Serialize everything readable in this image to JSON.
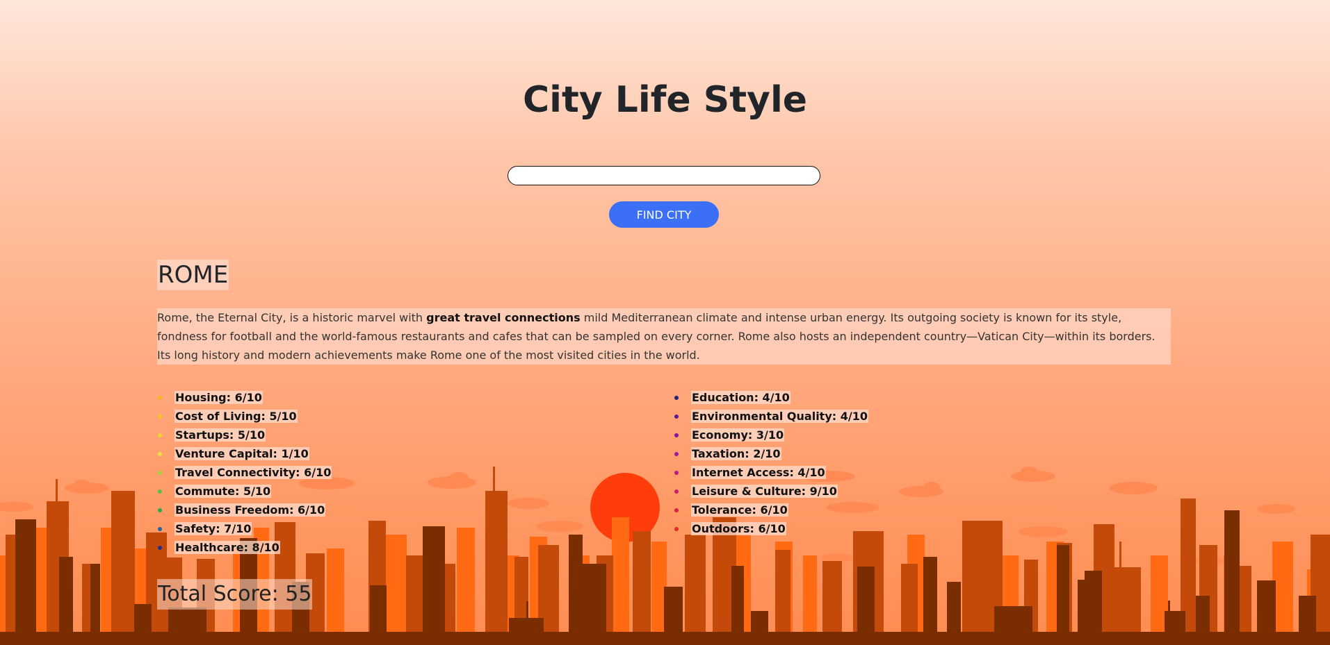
{
  "header": {
    "title": "City Life Style"
  },
  "search": {
    "value": "",
    "placeholder": "",
    "button_label": "FIND CITY"
  },
  "city": {
    "name": "ROME",
    "description_before": "Rome, the Eternal City, is a historic marvel with ",
    "description_bold": "great travel connections",
    "description_after": " mild Mediterranean climate and intense urban energy. Its outgoing society is known for its style, fondness for football and the world-famous restaurants and cafes that can be sampled on every corner. Rome also hosts an independent country—Vatican City—within its borders. Its long history and modern achievements make Rome one of the most visited cities in the world."
  },
  "scores": {
    "left": [
      {
        "label": "Housing: 6/10",
        "color": "#f5b324"
      },
      {
        "label": "Cost of Living: 5/10",
        "color": "#f3c42b"
      },
      {
        "label": "Startups: 5/10",
        "color": "#f1d631"
      },
      {
        "label": "Venture Capital: 1/10",
        "color": "#e8e23a"
      },
      {
        "label": "Travel Connectivity: 6/10",
        "color": "#a6d63b"
      },
      {
        "label": "Commute: 5/10",
        "color": "#50c43b"
      },
      {
        "label": "Business Freedom: 6/10",
        "color": "#2aa84f"
      },
      {
        "label": "Safety: 7/10",
        "color": "#24629d"
      },
      {
        "label": "Healthcare: 8/10",
        "color": "#1b2f8f"
      }
    ],
    "right": [
      {
        "label": "Education: 4/10",
        "color": "#25207a"
      },
      {
        "label": "Environmental Quality: 4/10",
        "color": "#5a1d93"
      },
      {
        "label": "Economy: 3/10",
        "color": "#7d1ba0"
      },
      {
        "label": "Taxation: 2/10",
        "color": "#9a1aa0"
      },
      {
        "label": "Internet Access: 4/10",
        "color": "#b51a8a"
      },
      {
        "label": "Leisure & Culture: 9/10",
        "color": "#c91a6c"
      },
      {
        "label": "Tolerance: 6/10",
        "color": "#d91d44"
      },
      {
        "label": "Outdoors: 6/10",
        "color": "#e52a2a"
      }
    ],
    "total_label": "Total Score: 55"
  },
  "theme": {
    "accent": "#3b6ff5",
    "sun": "#ff3d0a",
    "building_dark": "#7a2d00",
    "building_mid": "#c44a0a",
    "building_light": "#ff6a12"
  }
}
